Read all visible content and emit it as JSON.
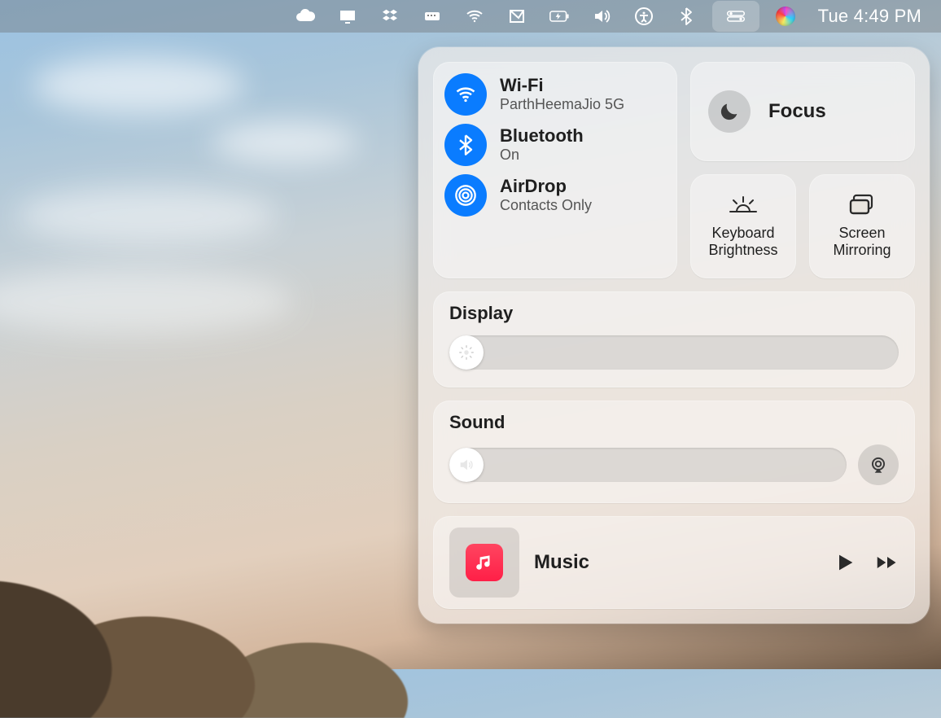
{
  "menubar": {
    "datetime": "Tue 4:49 PM"
  },
  "controlCenter": {
    "wifi": {
      "title": "Wi-Fi",
      "subtitle": "ParthHeemaJio 5G"
    },
    "bluetooth": {
      "title": "Bluetooth",
      "subtitle": "On"
    },
    "airdrop": {
      "title": "AirDrop",
      "subtitle": "Contacts Only"
    },
    "focus": {
      "title": "Focus"
    },
    "keyboardBrightness": {
      "label": "Keyboard Brightness"
    },
    "screenMirroring": {
      "label": "Screen Mirroring"
    },
    "display": {
      "heading": "Display",
      "value": 2
    },
    "sound": {
      "heading": "Sound",
      "value": 2
    },
    "music": {
      "title": "Music"
    }
  }
}
